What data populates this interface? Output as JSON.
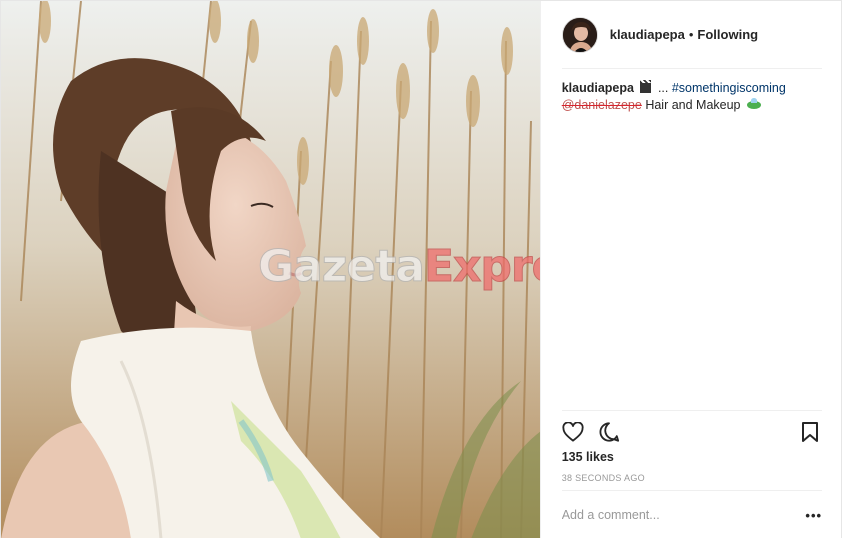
{
  "post": {
    "header": {
      "username": "klaudiapepa",
      "separator": "•",
      "follow_status": "Following"
    },
    "caption": {
      "username": "klaudiapepa",
      "ellipsis": "...",
      "hashtag": "#somethingiscoming",
      "mention": "@danielazepe",
      "text": "Hair and Makeup"
    },
    "actions": {
      "like_icon": "heart-icon",
      "comment_icon": "speech-bubble-icon",
      "save_icon": "bookmark-icon"
    },
    "likes": "135 likes",
    "timestamp": "38 SECONDS AGO",
    "comment": {
      "placeholder": "Add a comment...",
      "more_label": "•••"
    },
    "watermark": {
      "part1": "Gazeta",
      "part2": "Express"
    },
    "colors": {
      "hashtag": "#003569",
      "watermark_red": "#f06a6a",
      "text": "#262626",
      "muted": "#999999"
    }
  }
}
